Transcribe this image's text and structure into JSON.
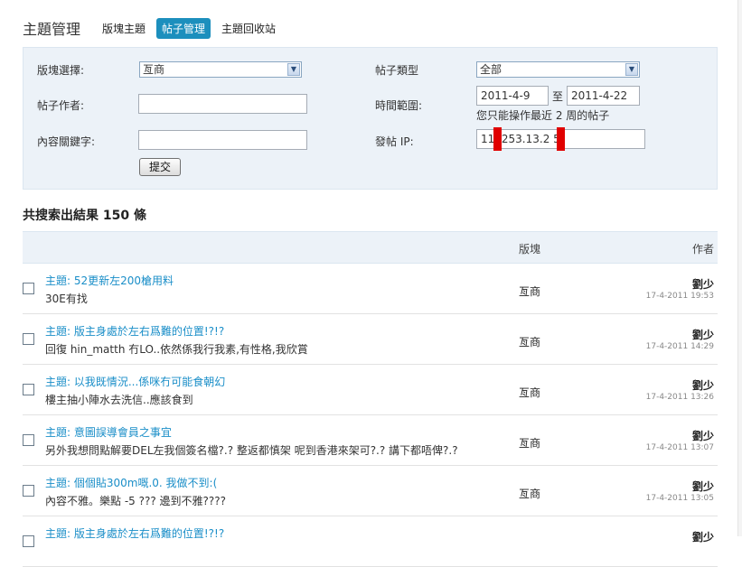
{
  "header": {
    "title": "主題管理",
    "tabs": [
      {
        "label": "版塊主題",
        "active": false
      },
      {
        "label": "帖子管理",
        "active": true
      },
      {
        "label": "主題回收站",
        "active": false
      }
    ]
  },
  "filter": {
    "forum_label": "版塊選擇:",
    "forum_value": "亙商",
    "type_label": "帖子類型",
    "type_value": "全部",
    "author_label": "帖子作者:",
    "author_value": "",
    "time_label": "時間範圍:",
    "time_from": "2011-4-9",
    "time_sep": "至",
    "time_to": "2011-4-22",
    "time_hint": "您只能操作最近 2 周的帖子",
    "keyword_label": "內容關鍵字:",
    "keyword_value": "",
    "ip_label": "發帖 IP:",
    "ip_value": "11  .253.13.2  5",
    "submit_label": "提交"
  },
  "result_count": "共搜索出結果 150 條",
  "table": {
    "col_forum": "版塊",
    "col_author": "作者",
    "rows": [
      {
        "title": "主題:  52更新左200槍用料",
        "snippet": "30E有找",
        "forum": "亙商",
        "author": "劉少",
        "time": "17-4-2011 19:53"
      },
      {
        "title": "主題:  版主身處於左右爲難的位置!?!?",
        "snippet": "回復 hin_matth 冇LO..依然係我行我素,有性格,我欣賞",
        "forum": "亙商",
        "author": "劉少",
        "time": "17-4-2011 14:29"
      },
      {
        "title": "主題:  以我既情況...係咪冇可能食朝幻",
        "snippet": "樓主抽小陣水去洗信..應該食到",
        "forum": "亙商",
        "author": "劉少",
        "time": "17-4-2011 13:26"
      },
      {
        "title": "主題:  意圖誤導會員之事宜",
        "snippet": "另外我想問點解要DEL左我個簽名檔?.? 整返都慎架 呢到香港來架可?.? 講下都唔俾?.?",
        "forum": "亙商",
        "author": "劉少",
        "time": "17-4-2011 13:07"
      },
      {
        "title": "主題:  個個貼300m嘅.0. 我做不到:(",
        "snippet": "內容不雅。樂點 -5 ??? 邊到不雅????",
        "forum": "亙商",
        "author": "劉少",
        "time": "17-4-2011 13:05"
      },
      {
        "title": "主題:  版主身處於左右爲難的位置!?!?",
        "snippet": "",
        "forum": "",
        "author": "劉少",
        "time": ""
      }
    ]
  }
}
